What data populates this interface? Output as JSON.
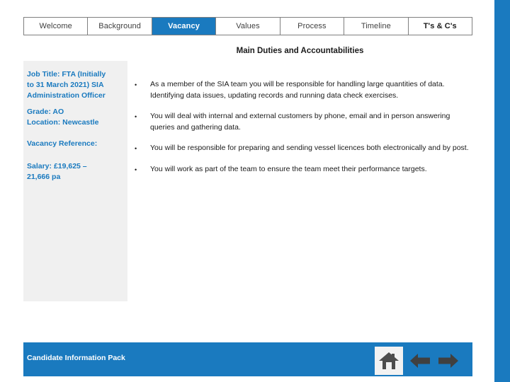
{
  "tabs": [
    {
      "label": "Welcome",
      "state": "normal"
    },
    {
      "label": "Background",
      "state": "normal"
    },
    {
      "label": "Vacancy",
      "state": "active"
    },
    {
      "label": "Values",
      "state": "normal"
    },
    {
      "label": "Process",
      "state": "normal"
    },
    {
      "label": "Timeline",
      "state": "normal"
    },
    {
      "label": "T's & C's",
      "state": "bold"
    }
  ],
  "section": {
    "title": "Main Duties and Accountabilities"
  },
  "job_info": {
    "job_title_line1": "Job Title: FTA (Initially",
    "job_title_line2": "to 31 March 2021) SIA",
    "job_title_line3": "Administration Officer",
    "grade": "Grade: AO",
    "location": "Location: Newcastle",
    "vacancy_reference": "Vacancy Reference:",
    "salary_line1": "Salary: £19,625 –",
    "salary_line2": "21,666 pa"
  },
  "duties": {
    "bullet_marker": "•",
    "items": [
      "As a member of the SIA team you will be responsible for handling large quantities of data. Identifying data issues, updating records and running data check exercises.",
      "You will deal with internal and external customers by phone, email and in person answering queries and gathering data.",
      "You will be responsible for preparing and sending vessel licences both electronically and by post.",
      "You will work as part of the team to ensure the team meet their performance targets."
    ]
  },
  "footer": {
    "label": "Candidate Information Pack",
    "icons": [
      "home-icon",
      "arrow-left-icon",
      "arrow-right-icon"
    ]
  },
  "colors": {
    "accent": "#1a7abf",
    "panel": "#f0f0f0",
    "text": "#1a1a1a"
  }
}
